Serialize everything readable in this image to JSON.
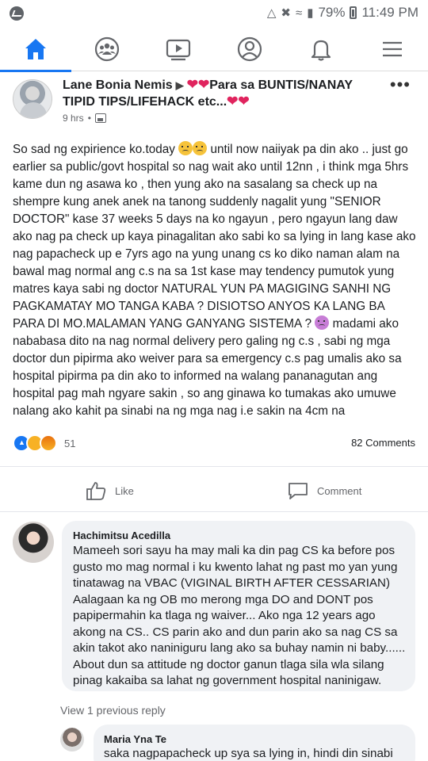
{
  "status_bar": {
    "battery": "79%",
    "time": "11:49 PM"
  },
  "nav": {
    "items": [
      {
        "icon": "home-icon",
        "active": true
      },
      {
        "icon": "groups-icon",
        "active": false
      },
      {
        "icon": "watch-icon",
        "active": false
      },
      {
        "icon": "profile-icon",
        "active": false
      },
      {
        "icon": "bell-icon",
        "active": false
      },
      {
        "icon": "menu-icon",
        "active": false
      }
    ],
    "accent": "#1877f2"
  },
  "post": {
    "author": "Lane Bonia Nemis",
    "group": "Para sa BUNTIS/NANAY TIPID TIPS/LIFEHACK etc...",
    "time": "9 hrs",
    "body_1": "So sad ng expirience ko.today ",
    "body_2": " until now naiiyak pa din ako .. just go earlier sa public/govt hospital so nag wait ako until 12nn , i think mga 5hrs kame dun ng asawa ko , then yung ako na sasalang sa check up na shempre kung anek anek na tanong suddenly nagalit yung \"SENIOR DOCTOR\" kase 37 weeks 5 days na ko ngayun , pero ngayun lang daw ako nag pa check up kaya pinagalitan ako sabi ko sa lying in lang kase ako nag papacheck up e 7yrs ago na yung unang cs ko diko naman alam na bawal mag normal ang c.s na sa 1st kase may tendency pumutok yung matres kaya sabi ng doctor NATURAL YUN PA MAGIGING SANHI NG PAGKAMATAY MO TANGA KABA ? DISIOTSO ANYOS KA LANG BA PARA DI MO.MALAMAN YANG GANYANG SISTEMA ? ",
    "body_3": " madami ako nababasa dito na nag normal delivery pero galing ng c.s , sabi ng mga doctor dun pipirma ako weiver para sa emergency c.s pag umalis ako sa hospital pipirma pa din ako to informed na walang pananagutan ang hospital pag mah ngyare sakin , so ang ginawa ko tumakas ako umuwe nalang ako kahit pa sinabi na ng mga nag i.e sakin na 4cm na",
    "reaction_count": "51",
    "comments_count": "82 Comments",
    "like_label": "Like",
    "comment_label": "Comment"
  },
  "comments": [
    {
      "name": "Hachimitsu Acedilla",
      "text": "Mameeh sori sayu ha may mali ka din pag CS ka before pos gusto mo mag normal i ku kwento lahat ng past mo yan yung tinatawag na VBAC (VIGINAL BIRTH AFTER CESSARIAN) Aalagaan ka ng OB mo merong mga DO and DONT pos papipermahin ka tlaga ng waiver... Ako nga 12 years ago akong na CS.. CS parin ako and dun parin ako sa nag CS sa akin  takot ako naniniguru lang ako sa buhay namin ni baby...... About dun sa attitude ng doctor ganun tlaga sila wla silang pinag kakaiba sa lahat ng government hospital naninigaw."
    },
    {
      "name": "Maria Yna Te",
      "text": "saka nagpapacheck up sya sa lying in, hindi din sinabi"
    }
  ],
  "view_previous": "View 1 previous reply"
}
